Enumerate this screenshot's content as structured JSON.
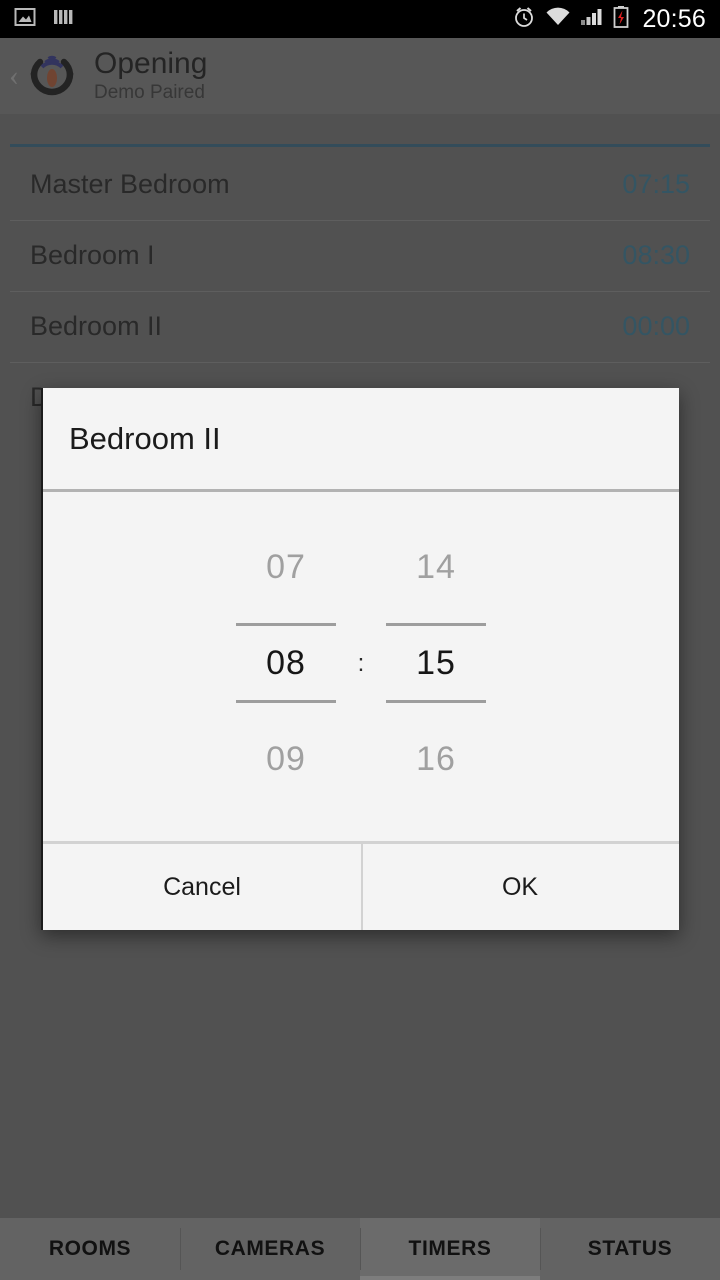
{
  "status_bar": {
    "left_icons": [
      "image-icon",
      "bars-icon"
    ],
    "right_icons": [
      "alarm-icon",
      "wifi-icon",
      "signal-icon",
      "battery-charging-icon"
    ],
    "time": "20:56"
  },
  "action_bar": {
    "back_icon": "back-chevron-icon",
    "app_icon": "opening-logo-icon",
    "title": "Opening",
    "subtitle": "Demo Paired"
  },
  "timer_list": [
    {
      "name": "Master Bedroom",
      "time": "07:15"
    },
    {
      "name": "Bedroom I",
      "time": "08:30"
    },
    {
      "name": "Bedroom II",
      "time": "00:00"
    },
    {
      "name": "D",
      "time": ""
    }
  ],
  "dialog": {
    "title": "Bedroom II",
    "picker": {
      "hours": {
        "above": "07",
        "selected": "08",
        "below": "09"
      },
      "separator": ":",
      "minutes": {
        "above": "14",
        "selected": "15",
        "below": "16"
      }
    },
    "cancel_label": "Cancel",
    "ok_label": "OK"
  },
  "tabs": [
    {
      "label": "ROOMS",
      "active": false
    },
    {
      "label": "CAMERAS",
      "active": false
    },
    {
      "label": "TIMERS",
      "active": true
    },
    {
      "label": "STATUS",
      "active": false
    }
  ],
  "colors": {
    "accent_line": "#2d5a74",
    "timer_time": "#2e6b84",
    "status_bar_bg": "#000000",
    "action_bar_bg": "#6e6e6e",
    "page_bg": "#636363",
    "dialog_bg": "#f4f4f4"
  }
}
